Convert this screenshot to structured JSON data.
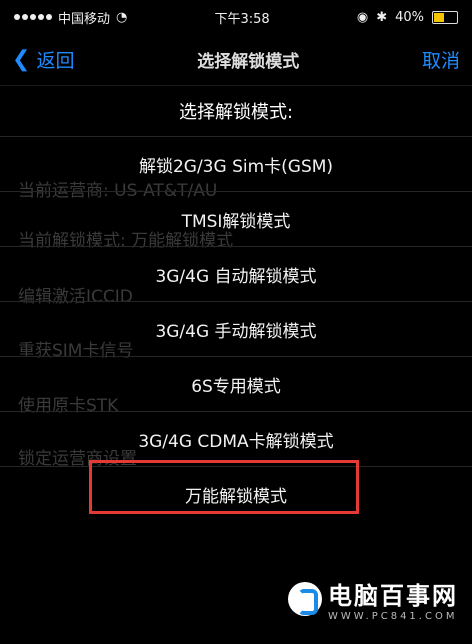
{
  "status_bar": {
    "carrier": "中国移动",
    "time": "下午3:58",
    "battery": "40%"
  },
  "navbar": {
    "back_label": "返回",
    "title": "选择解锁模式",
    "cancel_label": "取消"
  },
  "background_rows": [
    "当前运营商: US-AT&T/AU",
    "当前解锁模式: 万能解锁模式",
    "编辑激活ICCID",
    "重获SIM卡信号",
    "使用原卡STK",
    "锁定运营商设置"
  ],
  "sheet": {
    "title": "选择解锁模式:",
    "options": [
      "解锁2G/3G Sim卡(GSM)",
      "TMSI解锁模式",
      "3G/4G 自动解锁模式",
      "3G/4G 手动解锁模式",
      "6S专用模式",
      "3G/4G CDMA卡解锁模式",
      "万能解锁模式"
    ]
  },
  "watermark": {
    "name": "电脑百事网",
    "url": "WWW.PC841.COM"
  },
  "colors": {
    "accent": "#1e8bff",
    "highlight": "#e53935",
    "battery": "#f5c400"
  }
}
